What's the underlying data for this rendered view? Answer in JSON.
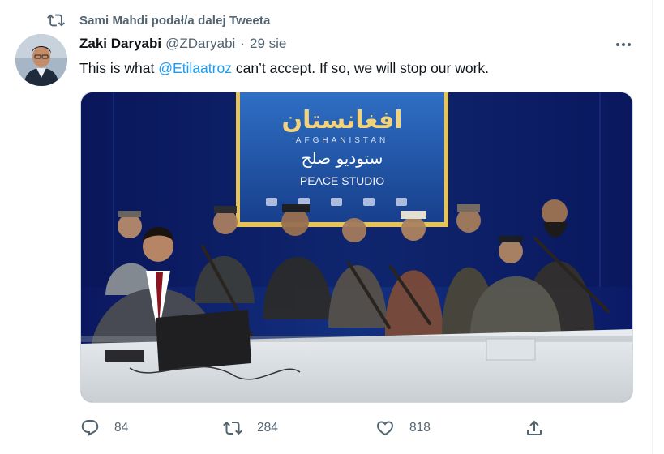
{
  "retweet_context": {
    "text": "Sami Mahdi podał/a dalej Tweeta"
  },
  "tweet": {
    "author_name": "Zaki Daryabi",
    "author_handle": "@ZDaryabi",
    "separator": "·",
    "date": "29 sie",
    "text_before": "This is what ",
    "mention": "@Etilaatroz",
    "text_after": " can’t accept. If so, we will stop our work."
  },
  "media": {
    "banner_title_arabic": "افغانستان",
    "banner_subtitle": "AFGHANISTAN",
    "banner_line_arabic": "ستوديو صلح",
    "banner_line_en": "PEACE STUDIO"
  },
  "actions": {
    "reply_count": "84",
    "retweet_count": "284",
    "like_count": "818"
  },
  "colors": {
    "accent": "#1d9bf0",
    "secondary_text": "#536471",
    "primary_text": "#0f1419"
  },
  "icons": [
    "retweet-icon",
    "more-icon",
    "reply-icon",
    "like-icon",
    "share-icon"
  ]
}
